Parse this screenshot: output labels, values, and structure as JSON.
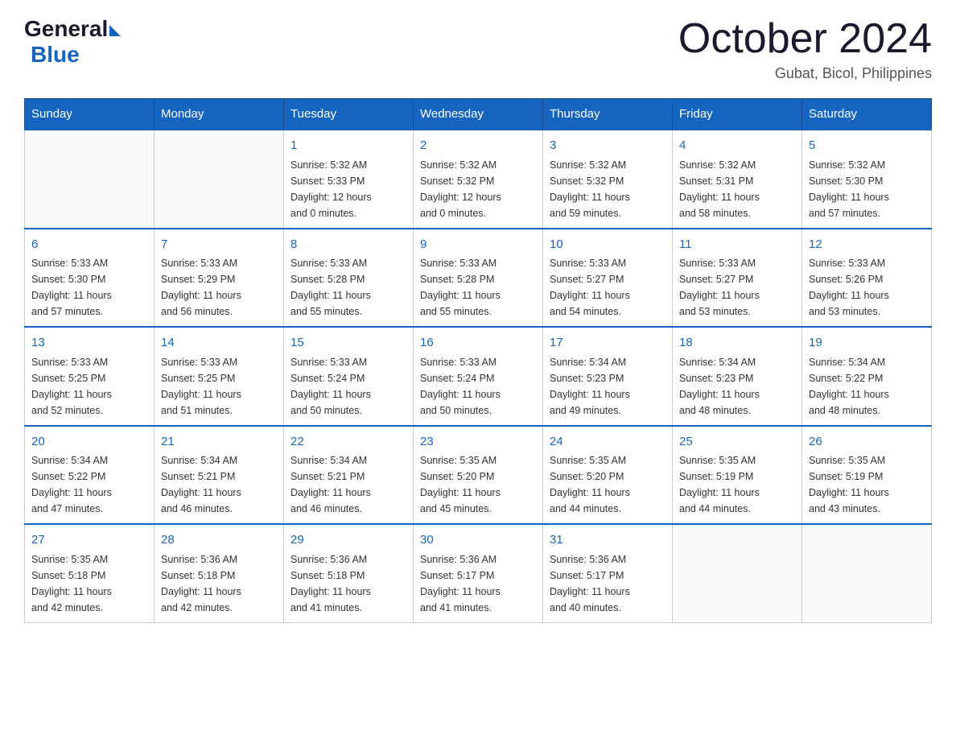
{
  "header": {
    "logo_text_general": "General",
    "logo_text_blue": "Blue",
    "month_year": "October 2024",
    "location": "Gubat, Bicol, Philippines"
  },
  "days_of_week": [
    "Sunday",
    "Monday",
    "Tuesday",
    "Wednesday",
    "Thursday",
    "Friday",
    "Saturday"
  ],
  "weeks": [
    [
      {
        "day": "",
        "info": ""
      },
      {
        "day": "",
        "info": ""
      },
      {
        "day": "1",
        "info": "Sunrise: 5:32 AM\nSunset: 5:33 PM\nDaylight: 12 hours\nand 0 minutes."
      },
      {
        "day": "2",
        "info": "Sunrise: 5:32 AM\nSunset: 5:32 PM\nDaylight: 12 hours\nand 0 minutes."
      },
      {
        "day": "3",
        "info": "Sunrise: 5:32 AM\nSunset: 5:32 PM\nDaylight: 11 hours\nand 59 minutes."
      },
      {
        "day": "4",
        "info": "Sunrise: 5:32 AM\nSunset: 5:31 PM\nDaylight: 11 hours\nand 58 minutes."
      },
      {
        "day": "5",
        "info": "Sunrise: 5:32 AM\nSunset: 5:30 PM\nDaylight: 11 hours\nand 57 minutes."
      }
    ],
    [
      {
        "day": "6",
        "info": "Sunrise: 5:33 AM\nSunset: 5:30 PM\nDaylight: 11 hours\nand 57 minutes."
      },
      {
        "day": "7",
        "info": "Sunrise: 5:33 AM\nSunset: 5:29 PM\nDaylight: 11 hours\nand 56 minutes."
      },
      {
        "day": "8",
        "info": "Sunrise: 5:33 AM\nSunset: 5:28 PM\nDaylight: 11 hours\nand 55 minutes."
      },
      {
        "day": "9",
        "info": "Sunrise: 5:33 AM\nSunset: 5:28 PM\nDaylight: 11 hours\nand 55 minutes."
      },
      {
        "day": "10",
        "info": "Sunrise: 5:33 AM\nSunset: 5:27 PM\nDaylight: 11 hours\nand 54 minutes."
      },
      {
        "day": "11",
        "info": "Sunrise: 5:33 AM\nSunset: 5:27 PM\nDaylight: 11 hours\nand 53 minutes."
      },
      {
        "day": "12",
        "info": "Sunrise: 5:33 AM\nSunset: 5:26 PM\nDaylight: 11 hours\nand 53 minutes."
      }
    ],
    [
      {
        "day": "13",
        "info": "Sunrise: 5:33 AM\nSunset: 5:25 PM\nDaylight: 11 hours\nand 52 minutes."
      },
      {
        "day": "14",
        "info": "Sunrise: 5:33 AM\nSunset: 5:25 PM\nDaylight: 11 hours\nand 51 minutes."
      },
      {
        "day": "15",
        "info": "Sunrise: 5:33 AM\nSunset: 5:24 PM\nDaylight: 11 hours\nand 50 minutes."
      },
      {
        "day": "16",
        "info": "Sunrise: 5:33 AM\nSunset: 5:24 PM\nDaylight: 11 hours\nand 50 minutes."
      },
      {
        "day": "17",
        "info": "Sunrise: 5:34 AM\nSunset: 5:23 PM\nDaylight: 11 hours\nand 49 minutes."
      },
      {
        "day": "18",
        "info": "Sunrise: 5:34 AM\nSunset: 5:23 PM\nDaylight: 11 hours\nand 48 minutes."
      },
      {
        "day": "19",
        "info": "Sunrise: 5:34 AM\nSunset: 5:22 PM\nDaylight: 11 hours\nand 48 minutes."
      }
    ],
    [
      {
        "day": "20",
        "info": "Sunrise: 5:34 AM\nSunset: 5:22 PM\nDaylight: 11 hours\nand 47 minutes."
      },
      {
        "day": "21",
        "info": "Sunrise: 5:34 AM\nSunset: 5:21 PM\nDaylight: 11 hours\nand 46 minutes."
      },
      {
        "day": "22",
        "info": "Sunrise: 5:34 AM\nSunset: 5:21 PM\nDaylight: 11 hours\nand 46 minutes."
      },
      {
        "day": "23",
        "info": "Sunrise: 5:35 AM\nSunset: 5:20 PM\nDaylight: 11 hours\nand 45 minutes."
      },
      {
        "day": "24",
        "info": "Sunrise: 5:35 AM\nSunset: 5:20 PM\nDaylight: 11 hours\nand 44 minutes."
      },
      {
        "day": "25",
        "info": "Sunrise: 5:35 AM\nSunset: 5:19 PM\nDaylight: 11 hours\nand 44 minutes."
      },
      {
        "day": "26",
        "info": "Sunrise: 5:35 AM\nSunset: 5:19 PM\nDaylight: 11 hours\nand 43 minutes."
      }
    ],
    [
      {
        "day": "27",
        "info": "Sunrise: 5:35 AM\nSunset: 5:18 PM\nDaylight: 11 hours\nand 42 minutes."
      },
      {
        "day": "28",
        "info": "Sunrise: 5:36 AM\nSunset: 5:18 PM\nDaylight: 11 hours\nand 42 minutes."
      },
      {
        "day": "29",
        "info": "Sunrise: 5:36 AM\nSunset: 5:18 PM\nDaylight: 11 hours\nand 41 minutes."
      },
      {
        "day": "30",
        "info": "Sunrise: 5:36 AM\nSunset: 5:17 PM\nDaylight: 11 hours\nand 41 minutes."
      },
      {
        "day": "31",
        "info": "Sunrise: 5:36 AM\nSunset: 5:17 PM\nDaylight: 11 hours\nand 40 minutes."
      },
      {
        "day": "",
        "info": ""
      },
      {
        "day": "",
        "info": ""
      }
    ]
  ]
}
